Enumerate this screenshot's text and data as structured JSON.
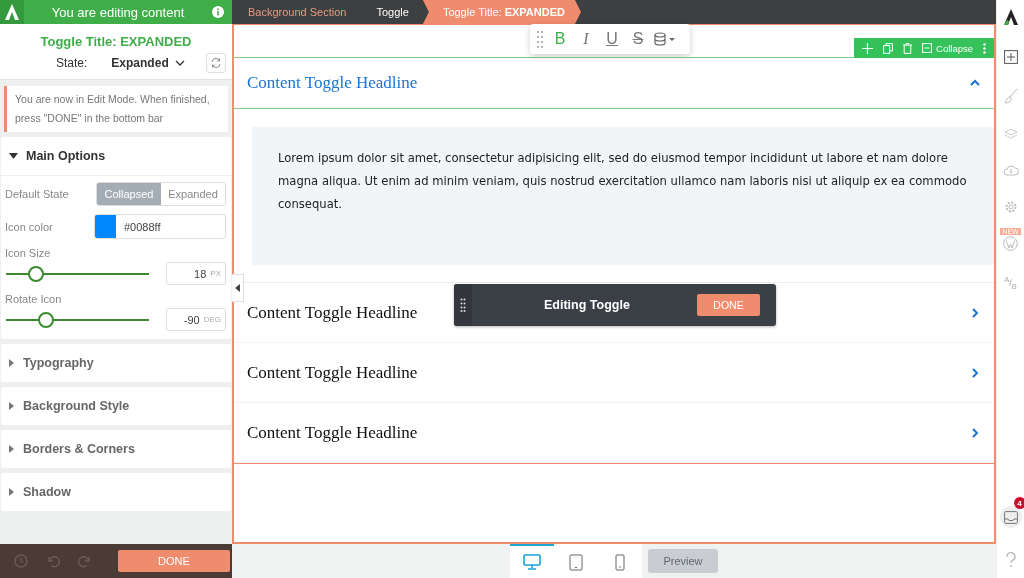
{
  "sidebar": {
    "header": "You are editing content",
    "title": "Toggle Title: EXPANDED",
    "state_label": "State:",
    "state_value": "Expanded",
    "notice": "You are now in Edit Mode. When finished, press \"DONE\" in the bottom bar",
    "sections": [
      {
        "title": "Main Options",
        "expanded": true
      },
      {
        "title": "Typography",
        "expanded": false
      },
      {
        "title": "Background Style",
        "expanded": false
      },
      {
        "title": "Borders & Corners",
        "expanded": false
      },
      {
        "title": "Shadow",
        "expanded": false
      }
    ],
    "default_state": {
      "label": "Default State",
      "options": [
        {
          "label": "Collapsed",
          "selected": true
        },
        {
          "label": "Expanded",
          "selected": false
        }
      ]
    },
    "icon_color": {
      "label": "Icon color",
      "value": "#0088ff",
      "color": "#0088ff"
    },
    "sliders": [
      {
        "label": "Icon Size",
        "level": 0.21,
        "value": "18",
        "unit": "PX"
      },
      {
        "label": "Rotate Icon",
        "level": 0.28,
        "value": "-90",
        "unit": "DEG"
      }
    ],
    "done": "DONE"
  },
  "breadcrumbs": [
    {
      "label": "Background Section",
      "selected": false
    },
    {
      "label": "Toggle",
      "selected": false
    },
    {
      "label": "Toggle Title: **EXPANDED**",
      "selected": true
    }
  ],
  "format_toolbar": [
    {
      "kind": "bold",
      "label": "B",
      "active": true
    },
    {
      "kind": "italic",
      "label": "I",
      "active": false
    },
    {
      "kind": "underline",
      "label": "U",
      "active": false
    },
    {
      "kind": "strike",
      "label": "S",
      "active": false
    }
  ],
  "element_bar": {
    "action": "Collapse"
  },
  "toggles": [
    {
      "title": "Content Toggle Headline",
      "expanded": true,
      "body": "Lorem ipsum dolor sit amet, consectetur adipisicing elit, sed do eiusmod tempor incididunt ut labore et nam dolore magna aliqua. Ut enim ad minim veniam, quis nostrud exercitation ullamco nam laboris nisi ut aliquip ex ea commodo consequat."
    },
    {
      "title": "Content Toggle Headline",
      "expanded": false
    },
    {
      "title": "Content Toggle Headline",
      "expanded": false
    },
    {
      "title": "Content Toggle Headline",
      "expanded": false
    }
  ],
  "editing_bar": {
    "title": "Editing Toggle",
    "done": "DONE"
  },
  "devices": [
    {
      "kind": "desktop",
      "selected": true
    },
    {
      "kind": "tablet",
      "selected": false
    },
    {
      "kind": "phone",
      "selected": false
    }
  ],
  "preview": "Preview",
  "rail": {
    "new_badge": "NEW",
    "ab_label": "$^{A}$/$_{B}$",
    "notification_count": "4"
  }
}
